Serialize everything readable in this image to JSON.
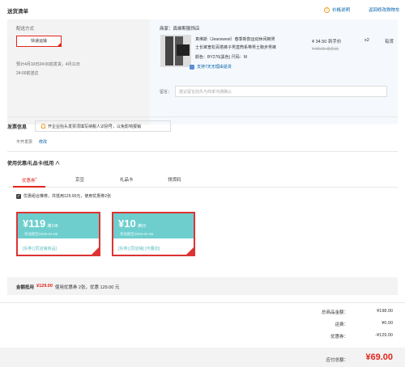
{
  "header": {
    "title": "送货清单",
    "price_info": "价格说明",
    "back_to_cart": "返回修改购物车"
  },
  "shipping": {
    "label": "配送方式",
    "method": "快递运输",
    "date_line1": "预计4月10日24:00前发货，4月11日",
    "date_line2": "24:00前送达"
  },
  "product": {
    "shop": "商家：真维斯服饰店",
    "title_line1": "真维斯（Jeanswest）春季新款运动休闲裤男",
    "title_line2": "士长裤宽松百搭裤子男直筒系带男士跑步男裤",
    "attrs": "颜色：BY276(黑色)    尺码：M",
    "service": "支持7天无理由退货",
    "price": "¥ 34.50 到手价",
    "old_price": "¥ 99.00 京东价",
    "qty": "x2",
    "stock": "有货",
    "remark_label": "留言：",
    "remark_placeholder": "建议留言前先与商家沟通确认"
  },
  "invoice": {
    "title": "发票信息",
    "tip": "开企业抬头发票须填写纳税人识别号，以免影响报销",
    "status": "不开发票",
    "edit": "修改"
  },
  "coupons": {
    "title": "使用优惠/礼品卡/抵用 ∧",
    "tabs": [
      "优惠券",
      "京豆",
      "礼品卡",
      "领货码"
    ],
    "tab_badge": "•",
    "recommend": "优惠组合推荐，共抵用129.00元，使用优惠券2张",
    "items": [
      {
        "amount": "¥119",
        "condition": "满198",
        "valid": "有效期至2025-04-09",
        "tags": "[东券] [同店铺商品]"
      },
      {
        "amount": "¥10",
        "condition": "满22",
        "valid": "有效期至2025-04-09",
        "tags": "[东券] [同店铺] [可叠加]"
      }
    ],
    "summary_prefix": "金额抵用",
    "summary_amount": "¥129.00",
    "summary_suffix": "使用优惠券 2张，优惠 129.00 元"
  },
  "totals": {
    "goods_label": "总商品金额：",
    "goods_value": "¥198.00",
    "freight_label": "运费：",
    "freight_value": "¥0.00",
    "coupon_label": "优惠券：",
    "coupon_value": "-¥129.00",
    "payable_label": "应付总额：",
    "payable_value": "¥69.00"
  },
  "colors": {
    "accent_red": "#e1251b",
    "link_blue": "#005ea7",
    "coupon_teal": "#6ecece"
  }
}
